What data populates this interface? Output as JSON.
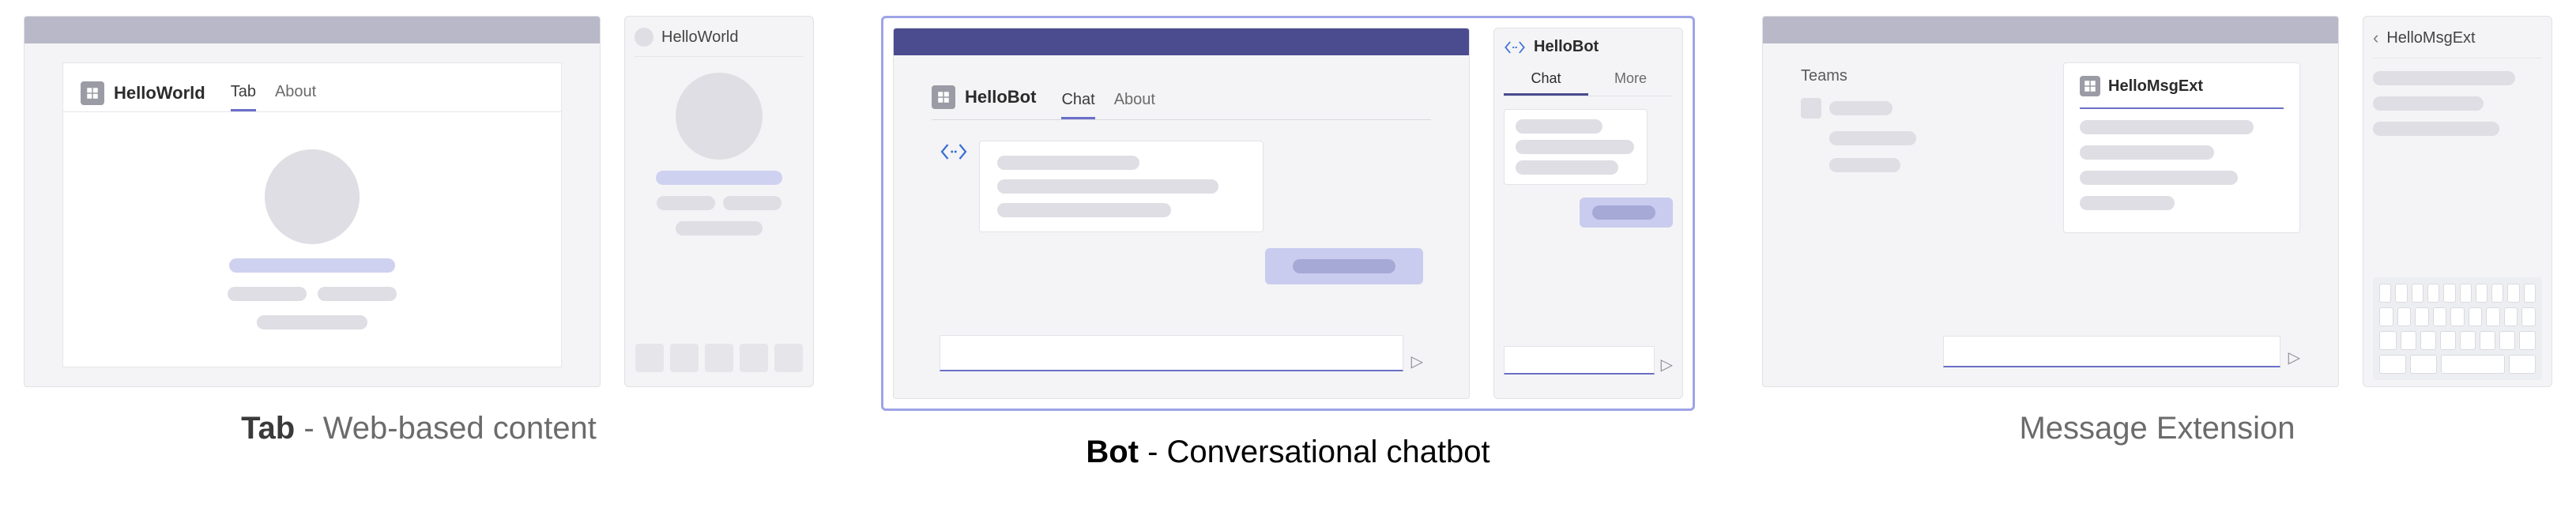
{
  "tab": {
    "desktop": {
      "app_name": "HelloWorld",
      "tabs": {
        "tab1": "Tab",
        "tab2": "About"
      }
    },
    "mobile": {
      "title": "HelloWorld"
    },
    "caption_strong": "Tab",
    "caption_rest": " - Web-based content"
  },
  "bot": {
    "desktop": {
      "app_name": "HelloBot",
      "tabs": {
        "tab1": "Chat",
        "tab2": "About"
      }
    },
    "mobile": {
      "title": "HelloBot",
      "tabs": {
        "tab1": "Chat",
        "tab2": "More"
      }
    },
    "caption_strong": "Bot",
    "caption_rest": " - Conversational chatbot"
  },
  "ext": {
    "desktop": {
      "sidebar_title": "Teams",
      "popup_title": "HelloMsgExt"
    },
    "mobile": {
      "title": "HelloMsgExt"
    },
    "caption": "Message Extension"
  }
}
